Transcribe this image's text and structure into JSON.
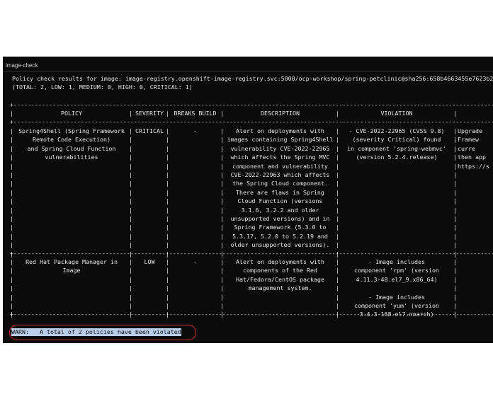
{
  "window": {
    "title": "image-check"
  },
  "output": {
    "result_line": "Policy check results for image: image-registry.openshift-image-registry.svc:5000/ocp-workshop/spring-petclinic@sha256:658b4663455e7623b2",
    "totals_line": "(TOTAL: 2, LOW: 1, MEDIUM: 0, HIGH: 0, CRITICAL: 1)"
  },
  "table": {
    "headers": [
      "POLICY",
      "SEVERITY",
      "BREAKS BUILD",
      "DESCRIPTION",
      "VIOLATION",
      ""
    ],
    "rows": [
      {
        "policy": "Spring4Shell (Spring Framework\nRemote Code Execution)\nand Spring Cloud Function\nvulnerabilities",
        "severity": "CRITICAL",
        "breaks_build": "-",
        "description": "Alert on deployments with\nimages containing Spring4Shell\nvulnerability CVE-2022-22965\nwhich affects the Spring MVC\ncomponent and vulnerability\nCVE-2022-22963 which affects\nthe Spring Cloud component.\nThere are flaws in Spring\nCloud Function (versions\n3.1.6, 3.2.2 and older\nunsupported versions) and in\nSpring Framework (5.3.0 to\n5.3.17, 5.2.0 to 5.2.19 and\nolder unsupported versions).",
        "violation": "- CVE-2022-22965 (CVSS 9.8)\n(severity Critical) found\nin component 'spring-webmvc'\n(version 5.2.4.release)",
        "remediation": "Upgrade\nFramew\ncurre\nthen app\nhttps://s"
      },
      {
        "policy": "Red Hat Package Manager in\nImage",
        "severity": "LOW",
        "breaks_build": "-",
        "description": "Alert on deployments with\ncomponents of the Red\nHat/Fedora/CentOS package\nmanagement system.",
        "violation": "- Image includes\ncomponent 'rpm' (version\n4.11.3-48.el7_9.x86_64)\n\n- Image includes\ncomponent 'yum' (version\n3.4.3-168.el7.noarch)",
        "remediation": ""
      }
    ]
  },
  "warning": {
    "text": "WARN:   A total of 2 policies have been violated"
  },
  "colors": {
    "terminal_bg": "#0b0b0b",
    "text": "#e6e6e6",
    "selection": "#b9cde9",
    "highlight_circle": "#d9302f"
  }
}
